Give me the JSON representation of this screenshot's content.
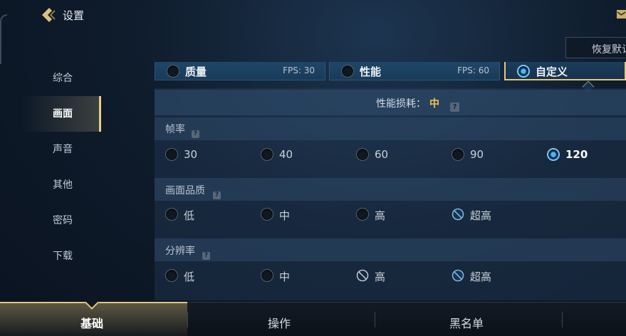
{
  "header": {
    "title": "设置",
    "restore_label": "恢复默认"
  },
  "sidebar": {
    "items": [
      {
        "label": "综合",
        "active": false
      },
      {
        "label": "画面",
        "active": true
      },
      {
        "label": "声音",
        "active": false
      },
      {
        "label": "其他",
        "active": false
      },
      {
        "label": "密码",
        "active": false
      },
      {
        "label": "下载",
        "active": false
      }
    ]
  },
  "modes": [
    {
      "label": "质量",
      "fps": "FPS: 30",
      "selected": false
    },
    {
      "label": "性能",
      "fps": "FPS: 60",
      "selected": false
    },
    {
      "label": "自定义",
      "fps": "",
      "selected": true
    }
  ],
  "performance": {
    "label": "性能损耗：",
    "value": "中",
    "help": "?"
  },
  "sections": {
    "frame_rate": {
      "title": "帧率",
      "help": "?",
      "options": [
        {
          "label": "30",
          "state": "off"
        },
        {
          "label": "40",
          "state": "off"
        },
        {
          "label": "60",
          "state": "off"
        },
        {
          "label": "90",
          "state": "off"
        },
        {
          "label": "120",
          "state": "on"
        }
      ]
    },
    "quality": {
      "title": "画面品质",
      "help": "?",
      "options": [
        {
          "label": "低",
          "state": "off"
        },
        {
          "label": "中",
          "state": "off"
        },
        {
          "label": "高",
          "state": "off"
        },
        {
          "label": "超高",
          "state": "disabled"
        }
      ]
    },
    "resolution": {
      "title": "分辨率",
      "help": "?",
      "options": [
        {
          "label": "低",
          "state": "off"
        },
        {
          "label": "中",
          "state": "off"
        },
        {
          "label": "高",
          "state": "disabled"
        },
        {
          "label": "超高",
          "state": "disabled"
        }
      ]
    }
  },
  "bottom_tabs": [
    {
      "label": "基础",
      "active": true
    },
    {
      "label": "操作",
      "active": false
    },
    {
      "label": "黑名单",
      "active": false
    }
  ],
  "colors": {
    "accent_gold": "#e3c77c",
    "perf_value": "#f2c548",
    "radio_on": "#47b7ff"
  }
}
